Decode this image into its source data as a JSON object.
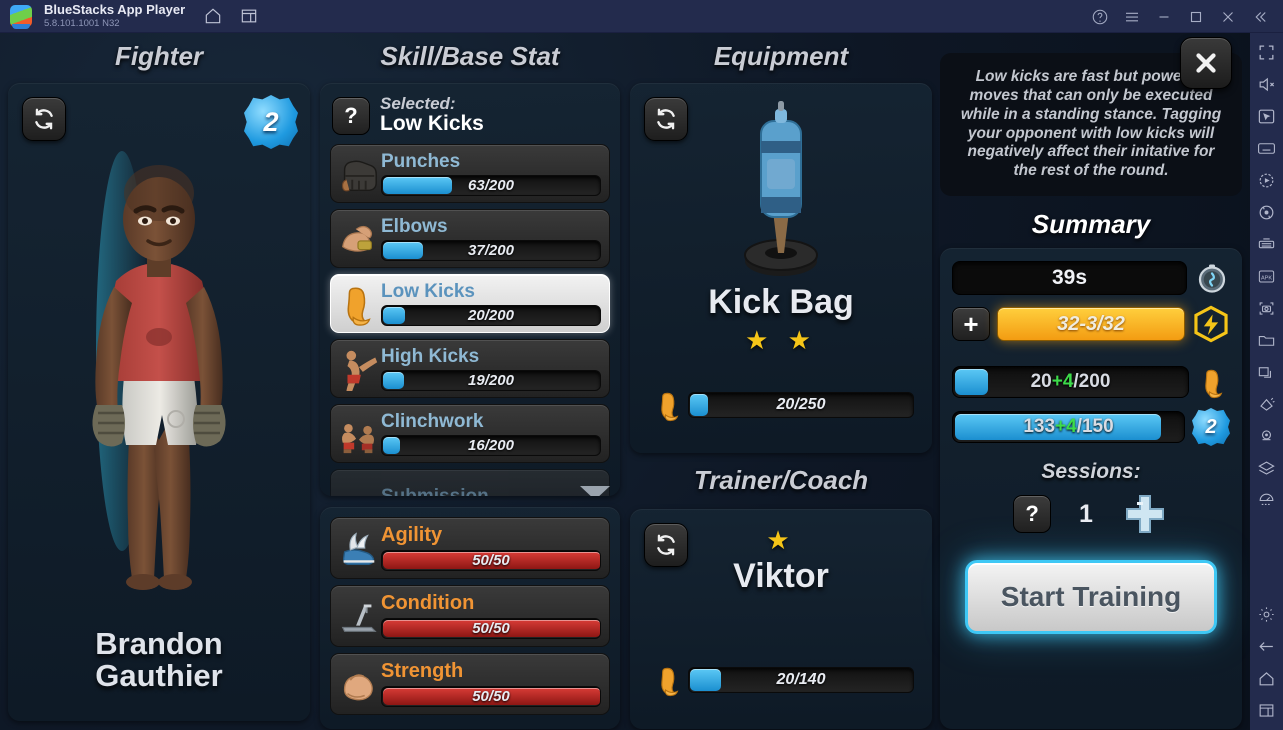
{
  "titlebar": {
    "app_name": "BlueStacks App Player",
    "version": "5.8.101.1001  N32",
    "icons": [
      "home-icon",
      "multi-instance-icon"
    ],
    "right_icons": [
      "help-icon",
      "menu-icon",
      "minimize-icon",
      "maximize-icon",
      "close-icon",
      "collapse-icon"
    ]
  },
  "rail": {
    "icons": [
      "fullscreen-icon",
      "mute-icon",
      "pointer-icon",
      "keyboard-icon",
      "record-icon",
      "rotate-icon",
      "macro-icon",
      "apk-install-icon",
      "screenshot-icon",
      "folder-icon",
      "multi-instance-icon",
      "tilt-icon",
      "location-icon",
      "layers-icon",
      "shake-icon"
    ],
    "bottom_icons": [
      "settings-icon",
      "back-icon",
      "home-icon",
      "recents-icon"
    ]
  },
  "fighter": {
    "title": "Fighter",
    "level": "2",
    "name_line1": "Brandon",
    "name_line2": "Gauthier",
    "reroll_icon": "refresh-icon"
  },
  "skills": {
    "title": "Skill/Base Stat",
    "selected_label": "Selected:",
    "selected_value": "Low Kicks",
    "help_icon": "question-icon",
    "list": [
      {
        "name": "Punches",
        "value": "63/200",
        "pct": 31.5,
        "icon": "glove-icon",
        "selected": false
      },
      {
        "name": "Elbows",
        "value": "37/200",
        "pct": 18.5,
        "icon": "elbow-icon",
        "selected": false
      },
      {
        "name": "Low Kicks",
        "value": "20/200",
        "pct": 10.0,
        "icon": "shin-icon",
        "selected": true
      },
      {
        "name": "High Kicks",
        "value": "19/200",
        "pct": 9.5,
        "icon": "highkick-icon",
        "selected": false
      },
      {
        "name": "Clinchwork",
        "value": "16/200",
        "pct": 8.0,
        "icon": "clinch-icon",
        "selected": false
      },
      {
        "name": "Submission",
        "value": "",
        "pct": 0,
        "icon": "submission-icon",
        "selected": false
      }
    ],
    "scroll_icon": "chevron-down-icon",
    "stats": [
      {
        "name": "Agility",
        "value": "50/50",
        "pct": 100,
        "icon": "winged-shoe-icon"
      },
      {
        "name": "Condition",
        "value": "50/50",
        "pct": 100,
        "icon": "treadmill-icon"
      },
      {
        "name": "Strength",
        "value": "50/50",
        "pct": 100,
        "icon": "biceps-icon"
      }
    ]
  },
  "equipment": {
    "title": "Equipment",
    "name": "Kick Bag",
    "stars": "★ ★",
    "progress_value": "20/250",
    "progress_pct": 8,
    "reroll_icon": "refresh-icon",
    "bar_icon": "shin-icon",
    "item_icon": "kick-bag-icon"
  },
  "trainer": {
    "title": "Trainer/Coach",
    "name": "Viktor",
    "stars": "★",
    "progress_value": "20/140",
    "progress_pct": 14,
    "reroll_icon": "refresh-icon",
    "bar_icon": "shin-icon"
  },
  "summary": {
    "description": "Low kicks are fast but powerful moves that can only be executed while in a standing stance. Tagging your opponent with low kicks will negatively affect their initative for the rest of the round.",
    "title": "Summary",
    "timer": "39s",
    "timer_icon": "stopwatch-icon",
    "energy_value": "32-3/32",
    "energy_current": "32",
    "energy_delta": "-3",
    "energy_max": "/32",
    "energy_icon": "lightning-icon",
    "energy_plus_icon": "plus-icon",
    "skill_current": "20",
    "skill_delta": "+4",
    "skill_max": "/200",
    "skill_pct": 10,
    "skill_icon": "shin-icon",
    "xp_current": "133",
    "xp_delta": "+4",
    "xp_max": "/150",
    "xp_pct": 89,
    "level_badge": "2",
    "sessions_label": "Sessions:",
    "sessions_count": "1",
    "sessions_help_icon": "question-icon",
    "sessions_add_icon": "plus-icon",
    "start_button": "Start Training",
    "close_icon": "close-icon"
  },
  "colors": {
    "accent_blue": "#3ec8f5",
    "energy_orange": "#f39c12",
    "stat_orange": "#f09434",
    "red_bar": "#d83b36",
    "green_delta": "#3ddc4a",
    "skill_name": "#8fb9d4"
  }
}
